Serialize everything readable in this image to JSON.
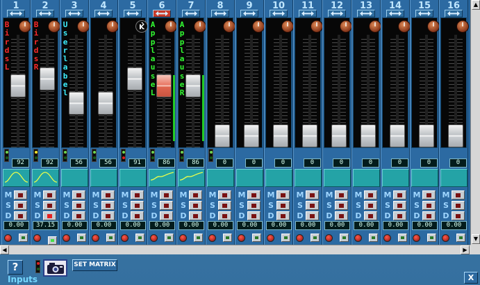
{
  "channels": [
    {
      "number": "1",
      "label": "BirdsL",
      "label_color": "#ff2a2a",
      "knob": "pan",
      "fader": 0.59,
      "fader_color": "normal",
      "meter": 0,
      "indicator": "green",
      "value": "92",
      "eq": "bell",
      "m": false,
      "s": false,
      "d": false,
      "gain": "0.00",
      "group_on": false
    },
    {
      "number": "2",
      "label": "BirdsR",
      "label_color": "#ff2a2a",
      "knob": "pan",
      "fader": 0.66,
      "fader_color": "normal",
      "meter": 0,
      "indicator": "yellow",
      "value": "92",
      "eq": "bell",
      "m": false,
      "s": false,
      "d": true,
      "gain": "37.15",
      "group_on": true
    },
    {
      "number": "3",
      "label": "User label",
      "label_color": "#3df0ff",
      "knob": "pan",
      "fader": 0.41,
      "fader_color": "normal",
      "meter": 0,
      "indicator": "green",
      "value": "56",
      "eq": "",
      "m": false,
      "s": false,
      "d": false,
      "gain": "0.00",
      "group_on": false
    },
    {
      "number": "4",
      "label": "",
      "label_color": "#ffffff",
      "knob": "pan",
      "fader": 0.41,
      "fader_color": "normal",
      "meter": 0,
      "indicator": "green",
      "value": "56",
      "eq": "",
      "m": false,
      "s": false,
      "d": false,
      "gain": "0.00",
      "group_on": false
    },
    {
      "number": "5",
      "label": "",
      "label_color": "#ffffff",
      "knob": "K",
      "fader": 0.66,
      "fader_color": "normal",
      "meter": 0,
      "indicator": "red",
      "value": "91",
      "eq": "",
      "m": false,
      "s": false,
      "d": false,
      "gain": "0.00",
      "group_on": false
    },
    {
      "number": "6",
      "label": "ApplauseL",
      "label_color": "#33ff33",
      "knob": "pan",
      "fader": 0.59,
      "fader_color": "red",
      "meter": 0.68,
      "indicator": "green",
      "value": "86",
      "eq": "ramp",
      "m": false,
      "s": false,
      "d": false,
      "gain": "0.00",
      "group_on": false
    },
    {
      "number": "7",
      "label": "ApplauseR",
      "label_color": "#33ff33",
      "knob": "pan",
      "fader": 0.59,
      "fader_color": "normal",
      "meter": 0.68,
      "indicator": "green",
      "value": "86",
      "eq": "ramp",
      "m": false,
      "s": false,
      "d": false,
      "gain": "0.00",
      "group_on": false
    },
    {
      "number": "8",
      "label": "",
      "label_color": "#ffffff",
      "knob": "pan",
      "fader": 0.07,
      "fader_color": "normal",
      "meter": 0,
      "indicator": "green",
      "value": "0",
      "eq": "",
      "m": false,
      "s": false,
      "d": false,
      "gain": "0.00",
      "group_on": false
    },
    {
      "number": "9",
      "label": "",
      "label_color": "#ffffff",
      "knob": "pan",
      "fader": 0.07,
      "fader_color": "normal",
      "meter": 0,
      "indicator": "none",
      "value": "0",
      "eq": "",
      "m": false,
      "s": false,
      "d": false,
      "gain": "0.00",
      "group_on": false
    },
    {
      "number": "10",
      "label": "",
      "label_color": "#ffffff",
      "knob": "pan",
      "fader": 0.07,
      "fader_color": "normal",
      "meter": 0,
      "indicator": "none",
      "value": "0",
      "eq": "",
      "m": false,
      "s": false,
      "d": false,
      "gain": "0.00",
      "group_on": false
    },
    {
      "number": "11",
      "label": "",
      "label_color": "#ffffff",
      "knob": "pan",
      "fader": 0.07,
      "fader_color": "normal",
      "meter": 0,
      "indicator": "none",
      "value": "0",
      "eq": "",
      "m": false,
      "s": false,
      "d": false,
      "gain": "0.00",
      "group_on": false
    },
    {
      "number": "12",
      "label": "",
      "label_color": "#ffffff",
      "knob": "pan",
      "fader": 0.07,
      "fader_color": "normal",
      "meter": 0,
      "indicator": "none",
      "value": "0",
      "eq": "",
      "m": false,
      "s": false,
      "d": false,
      "gain": "0.00",
      "group_on": false
    },
    {
      "number": "13",
      "label": "",
      "label_color": "#ffffff",
      "knob": "pan",
      "fader": 0.07,
      "fader_color": "normal",
      "meter": 0,
      "indicator": "none",
      "value": "0",
      "eq": "",
      "m": false,
      "s": false,
      "d": false,
      "gain": "0.00",
      "group_on": false
    },
    {
      "number": "14",
      "label": "",
      "label_color": "#ffffff",
      "knob": "pan",
      "fader": 0.07,
      "fader_color": "normal",
      "meter": 0,
      "indicator": "none",
      "value": "0",
      "eq": "",
      "m": false,
      "s": false,
      "d": false,
      "gain": "0.00",
      "group_on": false
    },
    {
      "number": "15",
      "label": "",
      "label_color": "#ffffff",
      "knob": "pan",
      "fader": 0.07,
      "fader_color": "normal",
      "meter": 0,
      "indicator": "none",
      "value": "0",
      "eq": "",
      "m": false,
      "s": false,
      "d": false,
      "gain": "0.00",
      "group_on": false
    },
    {
      "number": "16",
      "label": "",
      "label_color": "#ffffff",
      "knob": "pan",
      "fader": 0.07,
      "fader_color": "normal",
      "meter": 0,
      "indicator": "none",
      "value": "0",
      "eq": "",
      "m": false,
      "s": false,
      "d": false,
      "gain": "0.00",
      "group_on": false
    }
  ],
  "link_active": [
    false,
    false,
    false,
    false,
    false,
    true,
    false,
    false,
    false,
    false,
    false,
    false,
    false,
    false,
    false,
    false
  ],
  "msd_labels": {
    "m": "M",
    "s": "S",
    "d": "D"
  },
  "knob_letter": "K",
  "bottom": {
    "help_label": "?",
    "inputs_label": "Inputs",
    "set_matrix_label": "SET MATRIX",
    "close_label": "X",
    "camera_icon": "camera-icon"
  },
  "colors": {
    "accent": "#76d8ff",
    "background": "#2c6aa2",
    "eq_panel": "#24a3a6",
    "meter": "#23ca23"
  }
}
